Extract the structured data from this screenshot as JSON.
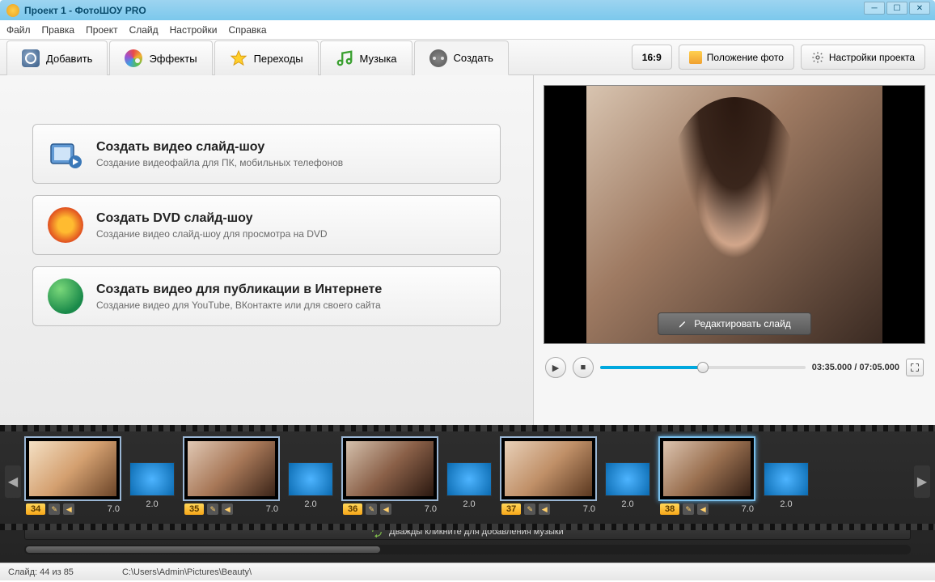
{
  "window": {
    "title": "Проект 1 - ФотоШОУ PRO"
  },
  "menu": {
    "file": "Файл",
    "edit": "Правка",
    "project": "Проект",
    "slide": "Слайд",
    "settings": "Настройки",
    "help": "Справка"
  },
  "tabs": {
    "add": "Добавить",
    "effects": "Эффекты",
    "transitions": "Переходы",
    "music": "Музыка",
    "create": "Создать"
  },
  "toolbar": {
    "aspect": "16:9",
    "photo_pos": "Положение фото",
    "proj_settings": "Настройки проекта"
  },
  "create_cards": [
    {
      "title": "Создать видео слайд-шоу",
      "desc": "Создание видеофайла для ПК, мобильных телефонов"
    },
    {
      "title": "Создать DVD слайд-шоу",
      "desc": "Создание видео слайд-шоу для просмотра на DVD"
    },
    {
      "title": "Создать видео для публикации в Интернете",
      "desc": "Создание видео для YouTube, ВКонтакте или для своего сайта"
    }
  ],
  "preview": {
    "edit_button": "Редактировать слайд",
    "time_current": "03:35.000",
    "time_total": "07:05.000",
    "progress_pct": 50
  },
  "timeline": {
    "slides": [
      {
        "num": "34",
        "duration": "7.0",
        "trans_dur": "2.0"
      },
      {
        "num": "35",
        "duration": "7.0",
        "trans_dur": "2.0"
      },
      {
        "num": "36",
        "duration": "7.0",
        "trans_dur": "2.0"
      },
      {
        "num": "37",
        "duration": "7.0",
        "trans_dur": "2.0"
      },
      {
        "num": "38",
        "duration": "7.0",
        "trans_dur": "2.0"
      }
    ],
    "music_hint": "Дважды кликните для добавления музыки"
  },
  "status": {
    "slide_counter": "Слайд: 44 из 85",
    "path": "C:\\Users\\Admin\\Pictures\\Beauty\\"
  }
}
